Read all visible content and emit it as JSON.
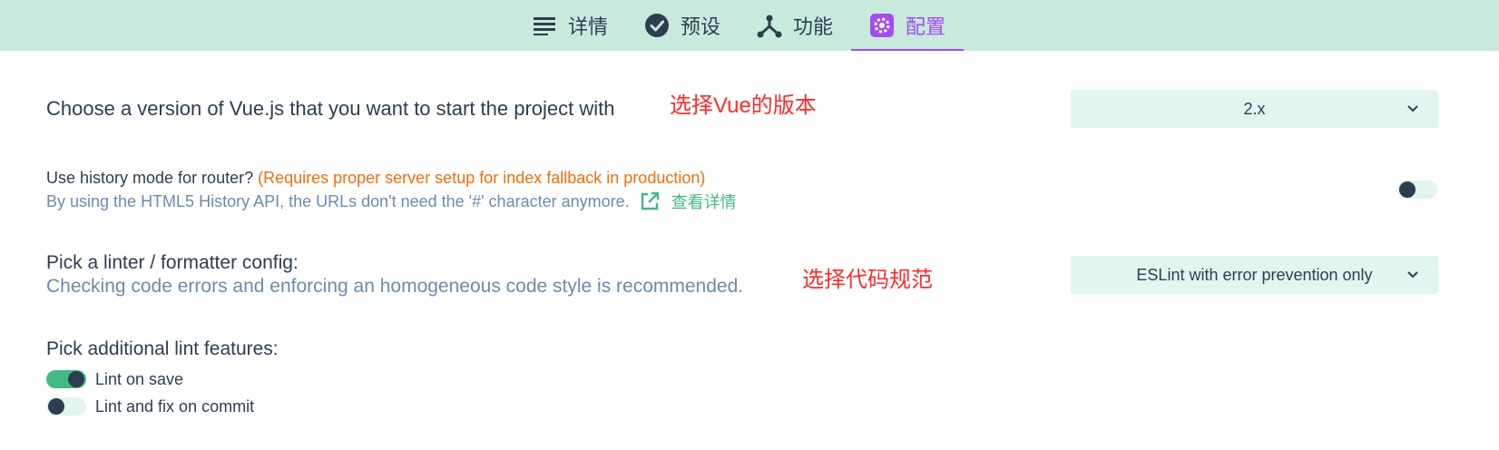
{
  "tabs": [
    {
      "label": "详情",
      "icon": "list-icon",
      "active": false
    },
    {
      "label": "预设",
      "icon": "check-circle-icon",
      "active": false
    },
    {
      "label": "功能",
      "icon": "fork-icon",
      "active": false
    },
    {
      "label": "配置",
      "icon": "gear-icon",
      "active": true
    }
  ],
  "colors": {
    "accent": "#a44cf1",
    "topbar": "#c8eadd",
    "green": "#42b983",
    "warning": "#f06e0c",
    "annotation": "#ff2a2a"
  },
  "vue_version": {
    "label": "Choose a version of Vue.js that you want to start the project with",
    "annotation": "选择Vue的版本",
    "selected": "2.x"
  },
  "history_mode": {
    "label": "Use history mode for router?",
    "warning": "(Requires proper server setup for index fallback in production)",
    "description": "By using the HTML5 History API, the URLs don't need the '#' character anymore.",
    "link_label": "查看详情",
    "enabled": false
  },
  "linter": {
    "label": "Pick a linter / formatter config:",
    "description": "Checking code errors and enforcing an homogeneous code style is recommended.",
    "annotation": "选择代码规范",
    "selected": "ESLint with error prevention only"
  },
  "lint_features": {
    "label": "Pick additional lint features:",
    "options": [
      {
        "label": "Lint on save",
        "enabled": true
      },
      {
        "label": "Lint and fix on commit",
        "enabled": false
      }
    ]
  }
}
